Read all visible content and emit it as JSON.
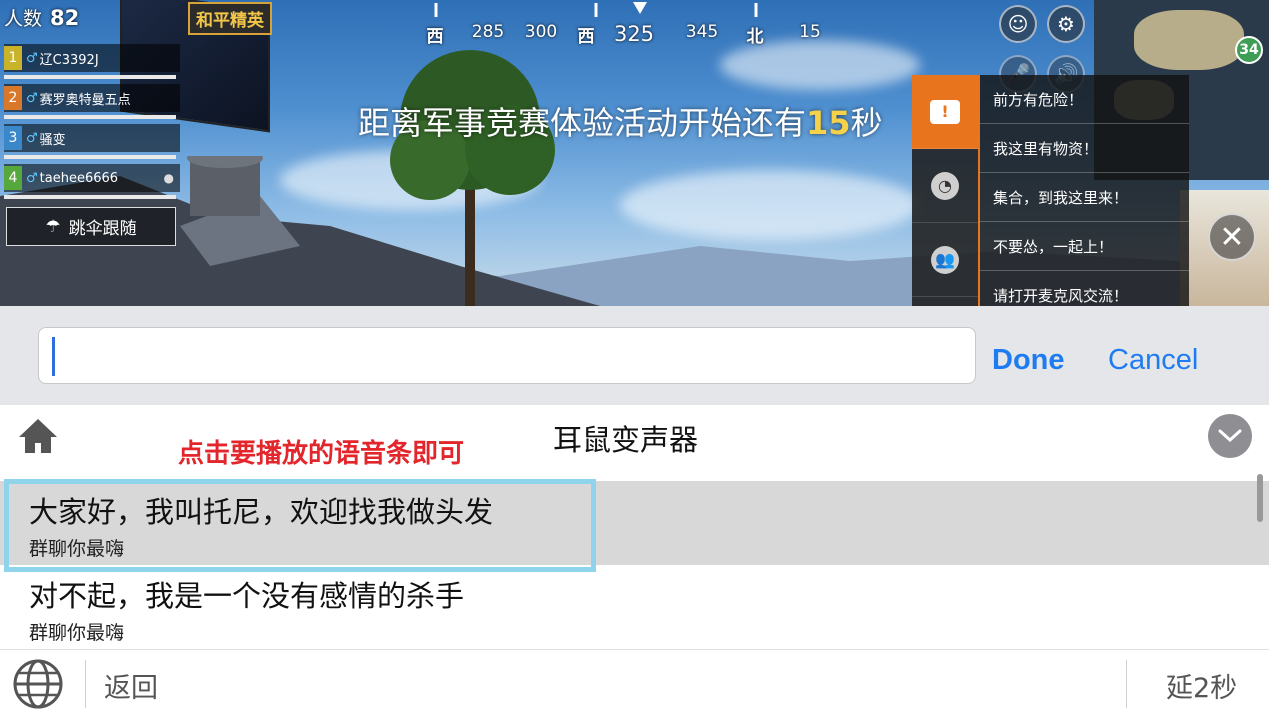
{
  "game": {
    "player_count_label": "人数",
    "player_count": "82",
    "billboard_label": "和平精英",
    "team": [
      {
        "idx": "1",
        "name": "辽C3392J",
        "color": "#c9b32b"
      },
      {
        "idx": "2",
        "name": "赛罗奥特曼五点",
        "color": "#d9772b"
      },
      {
        "idx": "3",
        "name": "骚变",
        "color": "#3a88c9"
      },
      {
        "idx": "4",
        "name": "taehee6666",
        "color": "#57a83c"
      }
    ],
    "follow_label": "跳伞跟随",
    "compass": [
      "西",
      "285",
      "300",
      "西",
      "325",
      "345",
      "北",
      "15"
    ],
    "countdown_prefix": "距离军事竞赛体验活动开始还有",
    "countdown_value": "15",
    "countdown_suffix": "秒",
    "map_badge": "34",
    "quick_messages": [
      "前方有危险！",
      "我这里有物资！",
      "集合，到我这里来！",
      "不要怂，一起上！",
      "请打开麦克风交流！"
    ]
  },
  "input": {
    "value": "",
    "done_label": "Done",
    "cancel_label": "Cancel"
  },
  "panel": {
    "tip": "点击要播放的语音条即可",
    "title": "耳鼠变声器",
    "items": [
      {
        "main": "大家好，我叫托尼，欢迎找我做头发",
        "sub": "群聊你最嗨"
      },
      {
        "main": "对不起，我是一个没有感情的杀手",
        "sub": "群聊你最嗨"
      }
    ],
    "back_label": "返回",
    "delay_label": "延2秒"
  },
  "colors": {
    "accent_blue": "#1f7cf0",
    "tip_red": "#e3262c",
    "orange": "#e8741e",
    "highlight": "#8fd4ea"
  }
}
